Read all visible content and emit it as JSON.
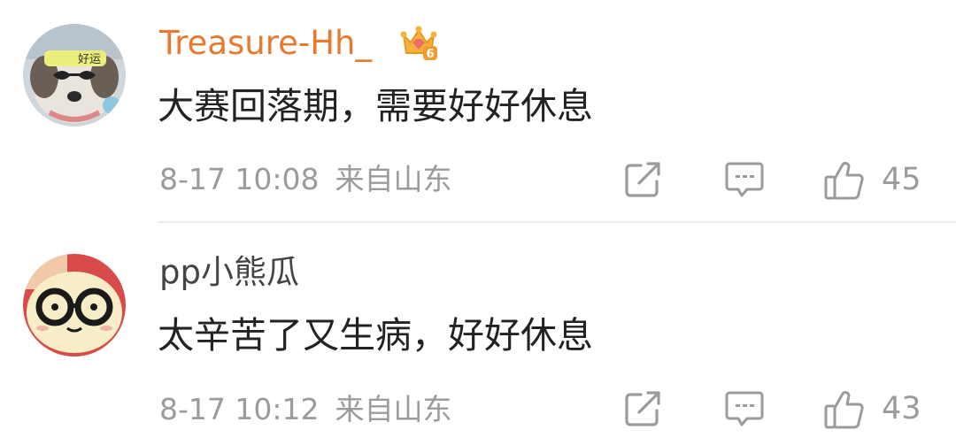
{
  "comments": [
    {
      "username": "Treasure-Hh_",
      "username_color": "#e8792f",
      "vip_level": "6",
      "avatar_icon": "dog-plush-with-sunglasses-avatar",
      "avatar_headband_text": "好运",
      "text": "大赛回落期，需要好好休息",
      "time": "8-17 10:08",
      "source": "来自山东",
      "likes": "45"
    },
    {
      "username": "pp小熊瓜",
      "username_color": "#444444",
      "avatar_icon": "bear-with-glasses-avatar",
      "text": "太辛苦了又生病，好好休息",
      "time": "8-17 10:12",
      "source": "来自山东",
      "likes": "43"
    }
  ],
  "icons": {
    "share": "share-icon",
    "reply": "comment-icon",
    "like": "thumbs-up-icon",
    "badge": "crown-badge-icon"
  }
}
